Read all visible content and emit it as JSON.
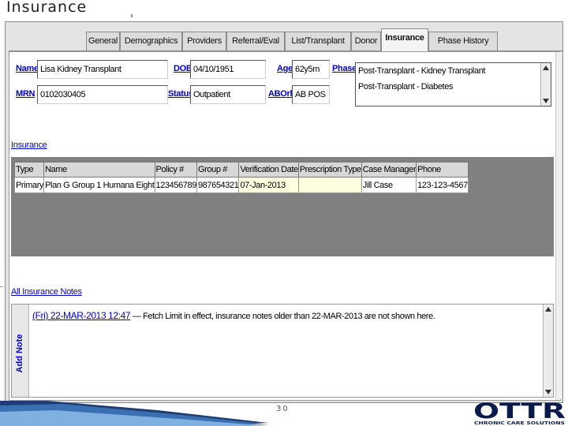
{
  "slide": {
    "title": "Insurance",
    "page_number": "30"
  },
  "tabs": [
    {
      "label": "General",
      "active": false
    },
    {
      "label": "Demographics",
      "active": false
    },
    {
      "label": "Providers",
      "active": false
    },
    {
      "label": "Referral/Eval",
      "active": false
    },
    {
      "label": "List/Transplant",
      "active": false
    },
    {
      "label": "Donor",
      "active": false
    },
    {
      "label": "Insurance",
      "active": true
    },
    {
      "label": "Phase History",
      "active": false
    }
  ],
  "patient": {
    "name_label": "Name",
    "name_value": "Lisa Kidney Transplant",
    "dob_label": "DOB",
    "dob_value": "04/10/1951",
    "age_label": "Age",
    "age_value": "62y5m",
    "phase_label": "Phase",
    "phases": [
      "Post-Transplant - Kidney Transplant",
      "Post-Transplant - Diabetes"
    ],
    "mrn_label": "MRN",
    "mrn_value": "0102030405",
    "status_label": "Status",
    "status_value": "Outpatient",
    "aborh_label": "ABOrh",
    "aborh_value": "AB POS"
  },
  "insurance_link": "Insurance",
  "insurance_table": {
    "columns": [
      "Type",
      "Name",
      "Policy #",
      "Group #",
      "Verification Date",
      "Prescription Type",
      "Case Manager",
      "Phone"
    ],
    "rows": [
      [
        "Primary",
        "Plan G Group 1 Humana Eight",
        "123456789",
        "987654321",
        "07-Jan-2013",
        "",
        "Jill Case",
        "123-123-4567"
      ]
    ]
  },
  "notes": {
    "all_notes_link": "All Insurance Notes",
    "add_note_label": "Add Note",
    "entry_date": "(Fri) 22-MAR-2013 12:47",
    "entry_text": " — Fetch Limit in effect, insurance notes older than 22-MAR-2013 are not shown here."
  },
  "logo": {
    "text": "OTTR",
    "tagline": "CHRONIC CARE SOLUTIONS",
    "brand_color": "#0a1a4a"
  }
}
